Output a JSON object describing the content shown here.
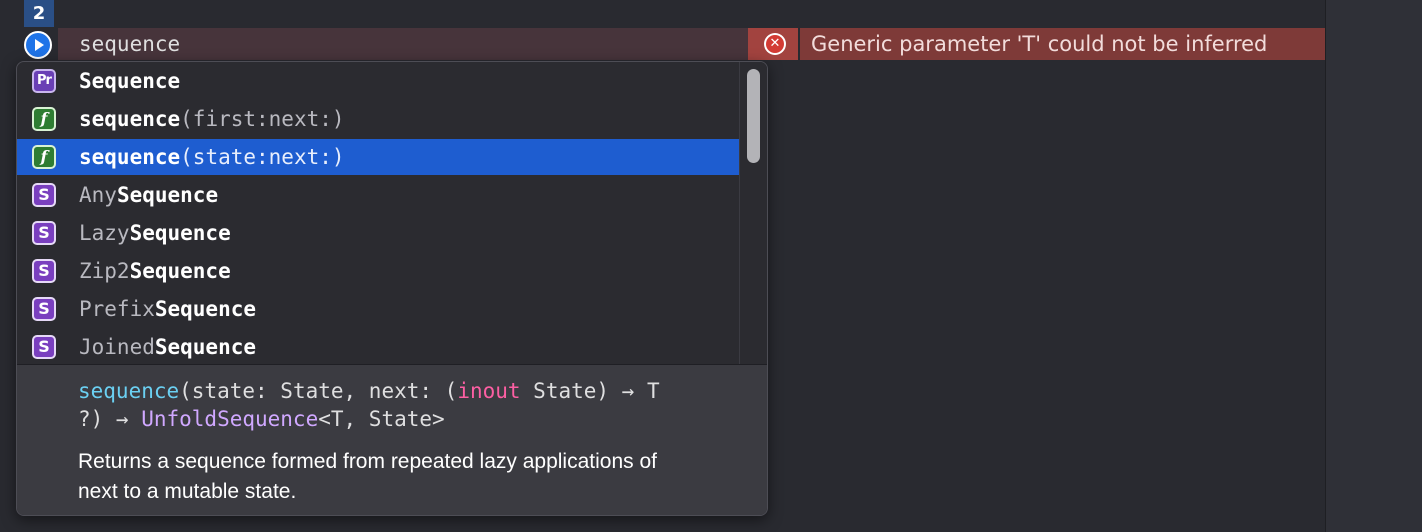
{
  "editor": {
    "line_number": "2",
    "code": "sequence"
  },
  "diagnostic": {
    "icon": "error-x-icon",
    "message": "Generic parameter 'T' could not be inferred"
  },
  "completions": {
    "selected_index": 2,
    "items": [
      {
        "kind": "protocol",
        "icon_label": "Pr",
        "prefix": "",
        "match": "Sequence",
        "suffix": ""
      },
      {
        "kind": "function",
        "icon_label": "f",
        "prefix": "",
        "match": "sequence",
        "suffix": "(first:next:)"
      },
      {
        "kind": "function",
        "icon_label": "f",
        "prefix": "",
        "match": "sequence",
        "suffix": "(state:next:)"
      },
      {
        "kind": "struct",
        "icon_label": "S",
        "prefix": "Any",
        "match": "Sequence",
        "suffix": ""
      },
      {
        "kind": "struct",
        "icon_label": "S",
        "prefix": "Lazy",
        "match": "Sequence",
        "suffix": ""
      },
      {
        "kind": "struct",
        "icon_label": "S",
        "prefix": "Zip2",
        "match": "Sequence",
        "suffix": ""
      },
      {
        "kind": "struct",
        "icon_label": "S",
        "prefix": "Prefix",
        "match": "Sequence",
        "suffix": ""
      },
      {
        "kind": "struct",
        "icon_label": "S",
        "prefix": "Joined",
        "match": "Sequence",
        "suffix": ""
      }
    ]
  },
  "documentation": {
    "signature": {
      "name": "sequence",
      "part1": "(state: State, next: (",
      "keyword": "inout",
      "part2": " State) → T\n?) → ",
      "return_type": "UnfoldSequence",
      "part3": "<T, State>"
    },
    "description": "Returns a sequence formed from repeated lazy applications of next to a mutable state."
  },
  "colors": {
    "selection": "#1e5dd0",
    "error_banner": "#7e3a38",
    "line_highlight": "#47343b"
  }
}
